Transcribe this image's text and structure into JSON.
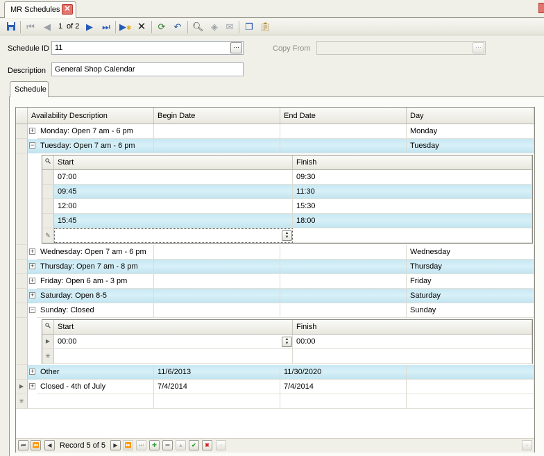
{
  "document_tab": {
    "title": "MR Schedules"
  },
  "toolbar": {
    "record_position": "1",
    "record_total": "of 2"
  },
  "form": {
    "schedule_id_label": "Schedule ID",
    "schedule_id_value": "11",
    "copy_from_label": "Copy From",
    "copy_from_value": "",
    "description_label": "Description",
    "description_value": "General Shop Calendar"
  },
  "inner_tab": {
    "label": "Schedule"
  },
  "grid": {
    "columns": [
      "Availability Description",
      "Begin Date",
      "End Date",
      "Day"
    ],
    "detail_columns": [
      "Start",
      "Finish"
    ],
    "rows": [
      {
        "desc": "Monday: Open 7 am - 6 pm",
        "begin": "",
        "end": "",
        "day": "Monday",
        "expanded": false
      },
      {
        "desc": "Tuesday: Open 7 am - 6 pm",
        "begin": "",
        "end": "",
        "day": "Tuesday",
        "expanded": true,
        "detail": [
          {
            "start": "07:00",
            "finish": "09:30"
          },
          {
            "start": "09:45",
            "finish": "11:30"
          },
          {
            "start": "12:00",
            "finish": "15:30"
          },
          {
            "start": "15:45",
            "finish": "18:00"
          }
        ]
      },
      {
        "desc": "Wednesday: Open 7 am - 6 pm",
        "begin": "",
        "end": "",
        "day": "Wednesday",
        "expanded": false
      },
      {
        "desc": "Thursday: Open 7 am - 8 pm",
        "begin": "",
        "end": "",
        "day": "Thursday",
        "expanded": false
      },
      {
        "desc": "Friday: Open 6 am - 3 pm",
        "begin": "",
        "end": "",
        "day": "Friday",
        "expanded": false
      },
      {
        "desc": "Saturday: Open 8-5",
        "begin": "",
        "end": "",
        "day": "Saturday",
        "expanded": false
      },
      {
        "desc": "Sunday: Closed",
        "begin": "",
        "end": "",
        "day": "Sunday",
        "expanded": true,
        "detail": [
          {
            "start": "00:00",
            "finish": "00:00"
          }
        ]
      },
      {
        "desc": "Other",
        "begin": "11/6/2013",
        "end": "11/30/2020",
        "day": "",
        "expanded": false
      },
      {
        "desc": "Closed - 4th of July",
        "begin": "7/4/2014",
        "end": "7/4/2014",
        "day": "",
        "expanded": false
      }
    ]
  },
  "navigator": {
    "record_text": "Record 5 of 5"
  },
  "colors": {
    "alt_row": "#c7e8f3",
    "add": "#2f9a2f",
    "cancel": "#d02020"
  }
}
